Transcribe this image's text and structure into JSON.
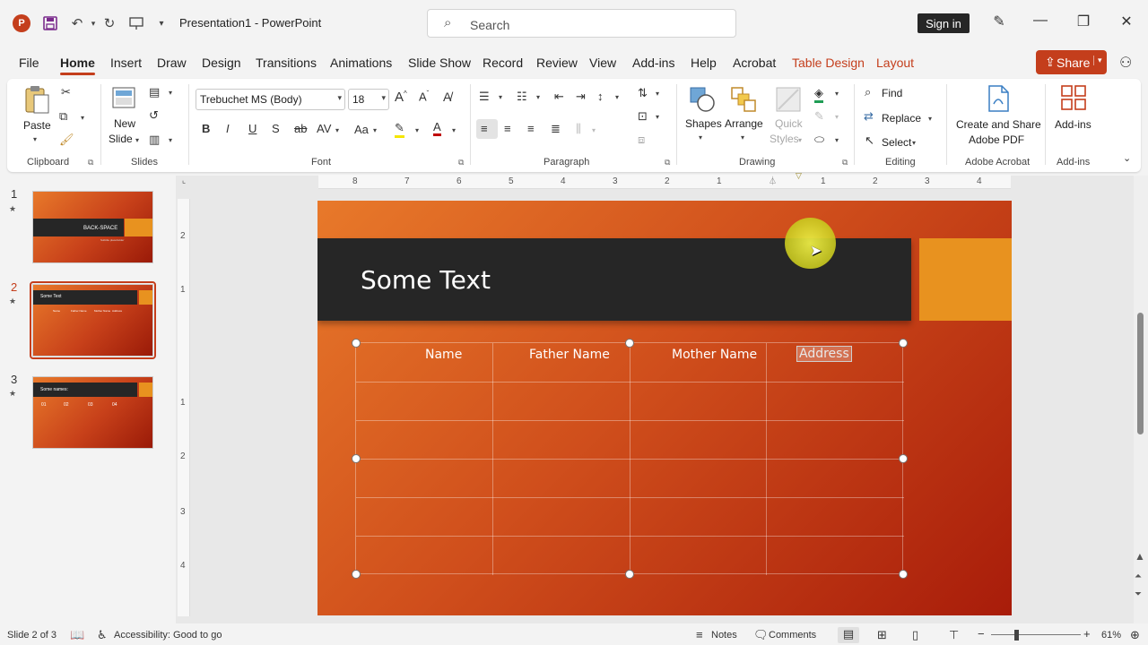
{
  "titlebar": {
    "doc_title": "Presentation1  -  PowerPoint",
    "search_placeholder": "Search",
    "signin": "Sign in",
    "app_logo": "P"
  },
  "tabs": [
    "File",
    "Home",
    "Insert",
    "Draw",
    "Design",
    "Transitions",
    "Animations",
    "Slide Show",
    "Record",
    "Review",
    "View",
    "Add-ins",
    "Help",
    "Acrobat",
    "Table Design",
    "Layout"
  ],
  "share": "Share",
  "ribbon": {
    "clipboard": {
      "label": "Clipboard",
      "paste": "Paste"
    },
    "slides": {
      "label": "Slides",
      "new_slide_1": "New",
      "new_slide_2": "Slide"
    },
    "font": {
      "label": "Font",
      "family": "Trebuchet MS (Body)",
      "size": "18"
    },
    "paragraph": {
      "label": "Paragraph"
    },
    "drawing": {
      "label": "Drawing",
      "shapes": "Shapes",
      "arrange": "Arrange",
      "quick_styles_1": "Quick",
      "quick_styles_2": "Styles"
    },
    "editing": {
      "label": "Editing",
      "find": "Find",
      "replace": "Replace",
      "select": "Select"
    },
    "acrobat": {
      "label": "Adobe Acrobat",
      "create_1": "Create and Share",
      "create_2": "Adobe PDF"
    },
    "addins": {
      "label": "Add-ins",
      "button": "Add-ins"
    }
  },
  "thumbnails": [
    {
      "num": "1",
      "title": "BACK-SPACE",
      "sub": "Subtitle placeholder"
    },
    {
      "num": "2",
      "title": "Some Text",
      "cols": [
        "Name",
        "Father Name",
        "Mother Name",
        "Address"
      ]
    },
    {
      "num": "3",
      "title": "Some names:",
      "items": [
        "01",
        "02",
        "03",
        "04"
      ]
    }
  ],
  "ruler": {
    "h": [
      "8",
      "7",
      "6",
      "5",
      "4",
      "3",
      "2",
      "1",
      "1",
      "2",
      "3",
      "4"
    ],
    "v": [
      "2",
      "1",
      "1",
      "2",
      "3",
      "4"
    ]
  },
  "slide": {
    "title": "Some Text",
    "table_headers": [
      "Name",
      "Father Name",
      "Mother Name"
    ],
    "selected_cell": "Address"
  },
  "statusbar": {
    "slide_info": "Slide 2 of 3",
    "accessibility": "Accessibility: Good to go",
    "notes": "Notes",
    "comments": "Comments",
    "zoom": "61%"
  },
  "colors": {
    "accent": "#c43e1c",
    "title_band": "#262626",
    "orange_block": "#e8921f"
  }
}
